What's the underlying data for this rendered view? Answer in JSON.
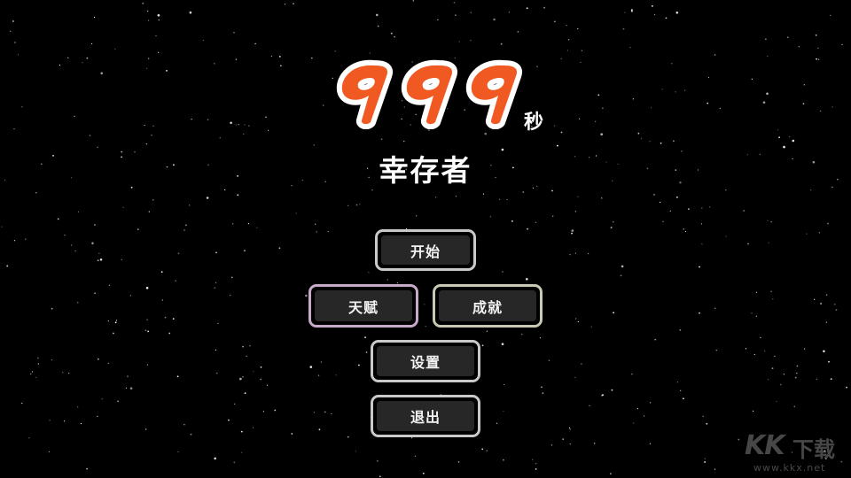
{
  "title": {
    "digits": "999",
    "unit": "秒",
    "subtitle": "幸存者",
    "digit_fill": "#f05a22",
    "digit_outline": "#ffffff"
  },
  "menu": {
    "start_label": "开始",
    "talent_label": "天赋",
    "achievement_label": "成就",
    "settings_label": "设置",
    "exit_label": "退出"
  },
  "watermark": {
    "brand": "KK",
    "brand_cn": "下载",
    "url": "www.kkx.net"
  },
  "colors": {
    "background": "#000000",
    "button_face": "#272727",
    "button_border": "#c9c9c9",
    "talent_border": "#c7a9c9",
    "achievement_border": "#c9c9b4"
  }
}
